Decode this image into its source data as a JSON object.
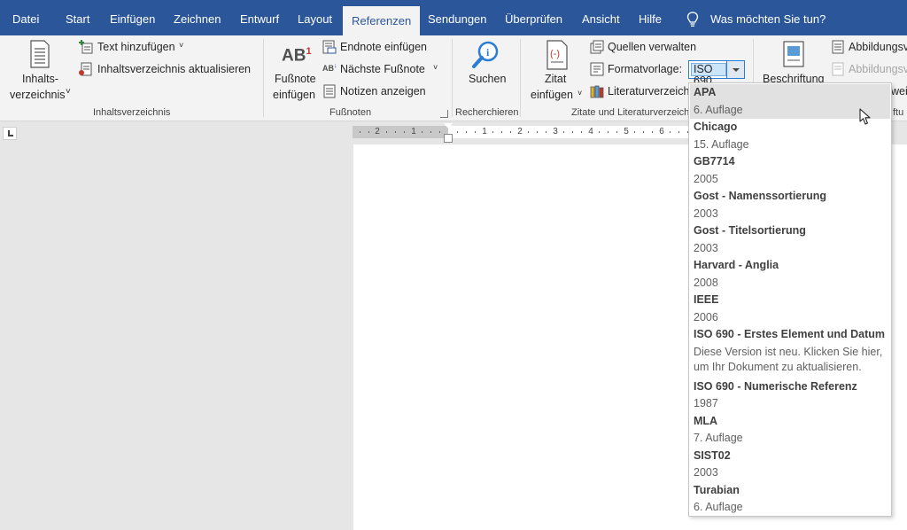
{
  "tabs": [
    "Datei",
    "Start",
    "Einfügen",
    "Zeichnen",
    "Entwurf",
    "Layout",
    "Referenzen",
    "Sendungen",
    "Überprüfen",
    "Ansicht",
    "Hilfe"
  ],
  "active_tab": "Referenzen",
  "tell_me": "Was möchten Sie tun?",
  "ribbon": {
    "toc": {
      "big_line1": "Inhalts-",
      "big_line2": "verzeichnis",
      "add_text": "Text hinzufügen",
      "update": "Inhaltsverzeichnis aktualisieren",
      "group": "Inhaltsverzeichnis"
    },
    "footnotes": {
      "insert_line1": "Fußnote",
      "insert_line2": "einfügen",
      "icon_text": "AB",
      "icon_sup": "1",
      "endnote": "Endnote einfügen",
      "next": "Nächste Fußnote",
      "show_notes": "Notizen anzeigen",
      "group": "Fußnoten"
    },
    "research": {
      "search": "Suchen",
      "group": "Recherchieren"
    },
    "citations": {
      "cite_line1": "Zitat",
      "cite_line2": "einfügen",
      "manage": "Quellen verwalten",
      "style_label": "Formatvorlage:",
      "style_value": "ISO 690",
      "bibliography": "Literaturverzeich",
      "group": "Zitate und Literaturverzeichnis"
    },
    "captions": {
      "caption": "Beschriftung",
      "insert_figures": "Abbildungsv",
      "update_table": "Abbildungsv",
      "cross_ref": "weis",
      "group_partial": "ftu"
    }
  },
  "ruler": {
    "left_numbers": [
      "2",
      "1"
    ],
    "right_numbers": [
      "1",
      "2",
      "3",
      "4",
      "5",
      "6"
    ]
  },
  "styles_dropdown": {
    "selected": "APA",
    "items": [
      {
        "name": "APA",
        "sub": [
          "6. Auflage"
        ]
      },
      {
        "name": "Chicago",
        "sub": [
          "15. Auflage"
        ]
      },
      {
        "name": "GB7714",
        "sub": [
          "2005"
        ]
      },
      {
        "name": "Gost - Namenssortierung",
        "sub": [
          "2003"
        ]
      },
      {
        "name": "Gost - Titelsortierung",
        "sub": [
          "2003"
        ]
      },
      {
        "name": "Harvard - Anglia",
        "sub": [
          "2008"
        ]
      },
      {
        "name": "IEEE",
        "sub": [
          "2006"
        ]
      },
      {
        "name": "ISO 690 - Erstes Element und Datum",
        "sub": [
          "Diese Version ist neu. Klicken Sie hier,",
          "um Ihr Dokument zu aktualisieren."
        ]
      },
      {
        "name": "ISO 690 - Numerische Referenz",
        "sub": [
          "1987"
        ]
      },
      {
        "name": "MLA",
        "sub": [
          "7. Auflage"
        ]
      },
      {
        "name": "SIST02",
        "sub": [
          "2003"
        ]
      },
      {
        "name": "Turabian",
        "sub": [
          "6. Auflage"
        ]
      }
    ]
  },
  "colors": {
    "title_bar": "#2b579a",
    "ribbon": "#f3f3f3",
    "accent": "#2b7cd3"
  }
}
